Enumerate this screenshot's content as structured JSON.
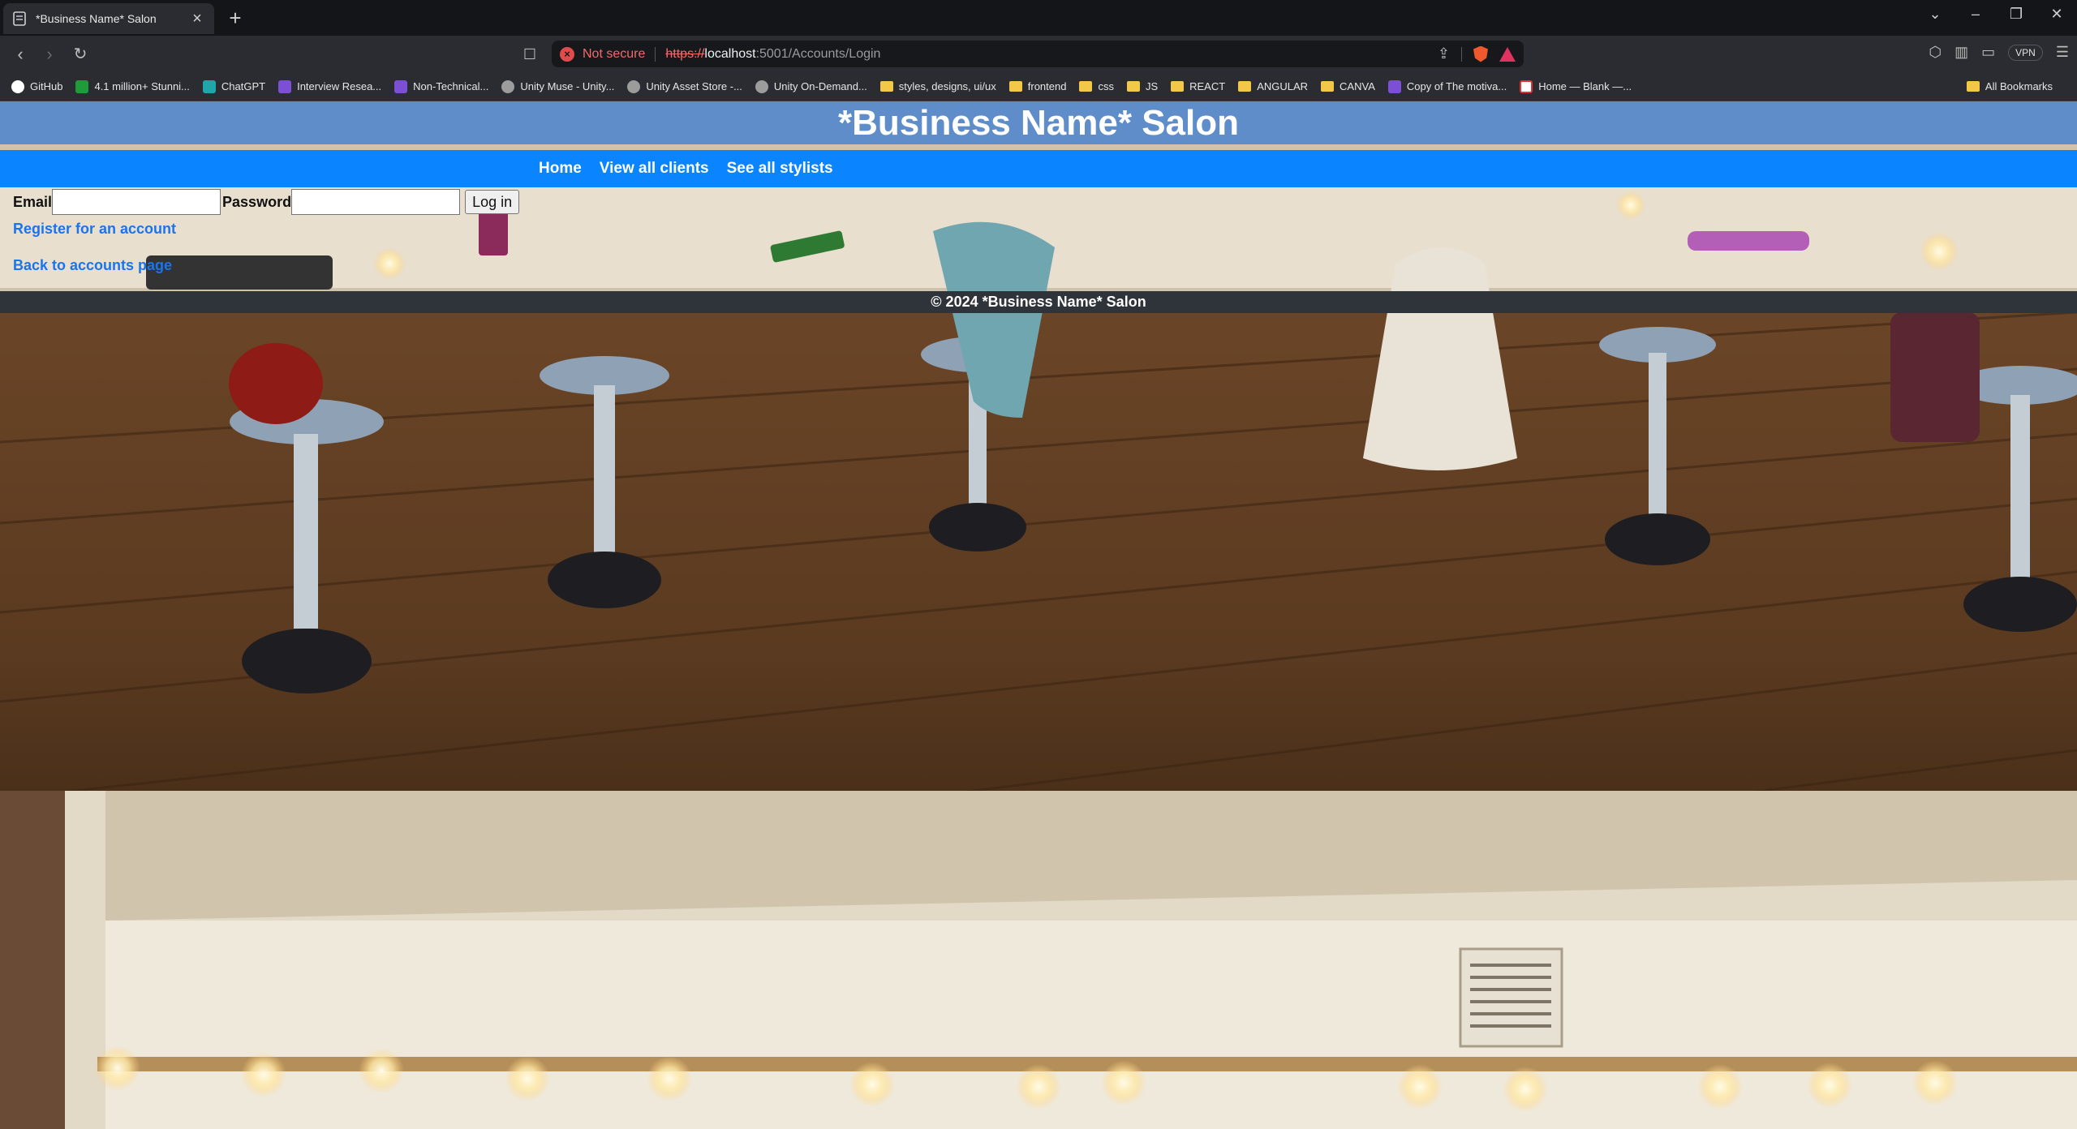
{
  "browser": {
    "tab_title": "*Business Name* Salon",
    "new_tab": "+",
    "address": {
      "security_label": "Not secure",
      "scheme": "https://",
      "host": "localhost",
      "path": ":5001/Accounts/Login"
    },
    "vpn_label": "VPN",
    "bookmarks": [
      {
        "label": "GitHub",
        "icon": "github-icon"
      },
      {
        "label": "4.1 million+ Stunni...",
        "icon": "pixabay-icon"
      },
      {
        "label": "ChatGPT",
        "icon": "chatgpt-icon"
      },
      {
        "label": "Interview Resea...",
        "icon": "site-icon"
      },
      {
        "label": "Non-Technical...",
        "icon": "site-icon"
      },
      {
        "label": "Unity Muse - Unity...",
        "icon": "unity-icon"
      },
      {
        "label": "Unity Asset Store -...",
        "icon": "unity-icon"
      },
      {
        "label": "Unity On-Demand...",
        "icon": "unity-icon"
      },
      {
        "label": "styles, designs, ui/ux",
        "icon": "folder-icon"
      },
      {
        "label": "frontend",
        "icon": "folder-icon"
      },
      {
        "label": "css",
        "icon": "folder-icon"
      },
      {
        "label": "JS",
        "icon": "folder-icon"
      },
      {
        "label": "REACT",
        "icon": "folder-icon"
      },
      {
        "label": "ANGULAR",
        "icon": "folder-icon"
      },
      {
        "label": "CANVA",
        "icon": "folder-icon"
      },
      {
        "label": "Copy of The motiva...",
        "icon": "site-icon"
      },
      {
        "label": "Home — Blank —...",
        "icon": "doc-icon"
      }
    ],
    "all_bookmarks": "All Bookmarks"
  },
  "site": {
    "title": "*Business Name* Salon",
    "nav": {
      "home": "Home",
      "clients": "View all clients",
      "stylists": "See all stylists"
    },
    "login": {
      "email_label": "Email",
      "email_value": "",
      "password_label": "Password",
      "password_value": "",
      "submit": "Log in"
    },
    "register_link": "Register for an account",
    "back_link": "Back to accounts page",
    "footer": "© 2024 *Business Name* Salon"
  },
  "colors": {
    "header_bg": "#5e8dc9",
    "nav_bg": "#0a84ff",
    "link": "#1874f0",
    "footer_bg": "#2f343a"
  }
}
